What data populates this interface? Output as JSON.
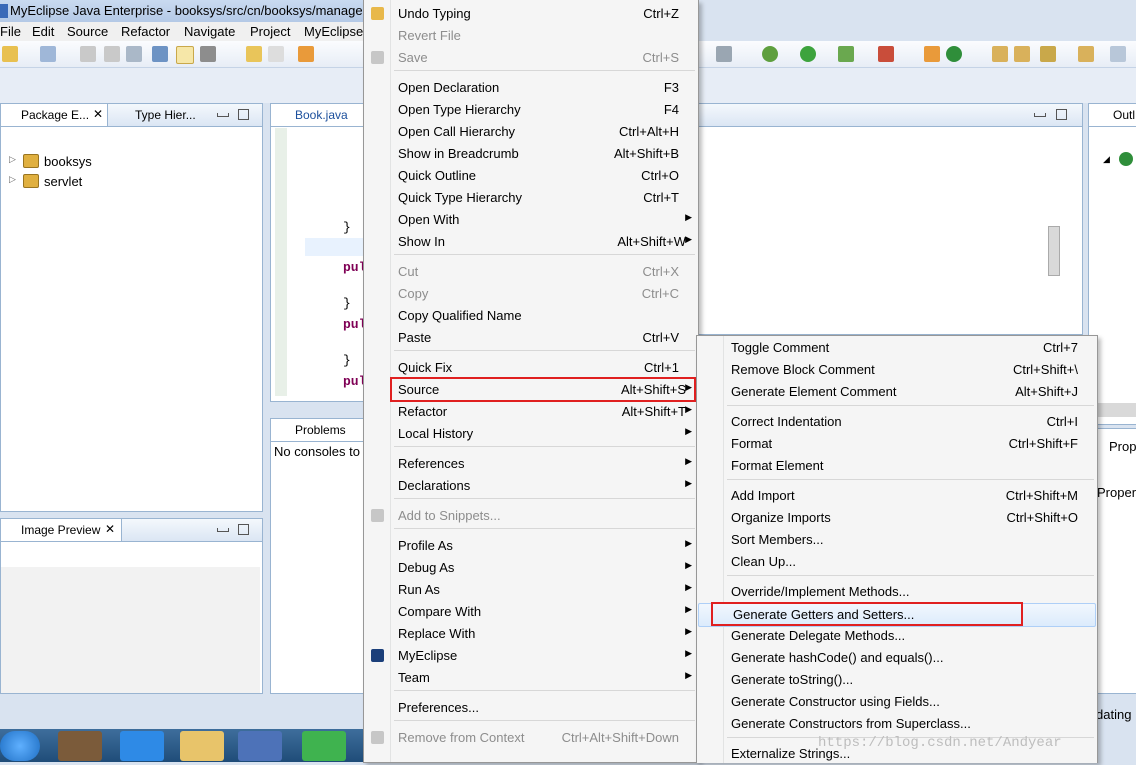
{
  "window": {
    "title": "MyEclipse Java Enterprise - booksys/src/cn/booksys/manage"
  },
  "menubar": [
    "File",
    "Edit",
    "Source",
    "Refactor",
    "Navigate",
    "Project",
    "MyEclipse"
  ],
  "package_explorer": {
    "tabs": [
      "Package E...",
      "Type Hier..."
    ],
    "projects": [
      "booksys",
      "servlet"
    ]
  },
  "editor": {
    "tab": "Book.java",
    "lines": [
      "}",
      "pul",
      "}",
      "pul",
      "}",
      "pul"
    ]
  },
  "bottom_panel": {
    "tab": "Problems",
    "message": "No consoles to"
  },
  "image_preview": {
    "tab": "Image Preview"
  },
  "right_panel": {
    "outline_tab": "Outl",
    "prop_tab": "Prop",
    "prop_text": "Proper",
    "status_text": "dating"
  },
  "context_menu": {
    "items": [
      {
        "label": "Undo Typing",
        "shortcut": "Ctrl+Z",
        "enabled": true,
        "submenu": false
      },
      {
        "label": "Revert File",
        "shortcut": "",
        "enabled": false,
        "submenu": false
      },
      {
        "label": "Save",
        "shortcut": "Ctrl+S",
        "enabled": false,
        "submenu": false
      },
      {
        "label": "Open Declaration",
        "shortcut": "F3",
        "enabled": true,
        "submenu": false
      },
      {
        "label": "Open Type Hierarchy",
        "shortcut": "F4",
        "enabled": true,
        "submenu": false
      },
      {
        "label": "Open Call Hierarchy",
        "shortcut": "Ctrl+Alt+H",
        "enabled": true,
        "submenu": false
      },
      {
        "label": "Show in Breadcrumb",
        "shortcut": "Alt+Shift+B",
        "enabled": true,
        "submenu": false
      },
      {
        "label": "Quick Outline",
        "shortcut": "Ctrl+O",
        "enabled": true,
        "submenu": false
      },
      {
        "label": "Quick Type Hierarchy",
        "shortcut": "Ctrl+T",
        "enabled": true,
        "submenu": false
      },
      {
        "label": "Open With",
        "shortcut": "",
        "enabled": true,
        "submenu": true
      },
      {
        "label": "Show In",
        "shortcut": "Alt+Shift+W",
        "enabled": true,
        "submenu": true
      },
      {
        "label": "Cut",
        "shortcut": "Ctrl+X",
        "enabled": false,
        "submenu": false
      },
      {
        "label": "Copy",
        "shortcut": "Ctrl+C",
        "enabled": false,
        "submenu": false
      },
      {
        "label": "Copy Qualified Name",
        "shortcut": "",
        "enabled": true,
        "submenu": false
      },
      {
        "label": "Paste",
        "shortcut": "Ctrl+V",
        "enabled": true,
        "submenu": false
      },
      {
        "label": "Quick Fix",
        "shortcut": "Ctrl+1",
        "enabled": true,
        "submenu": false
      },
      {
        "label": "Source",
        "shortcut": "Alt+Shift+S",
        "enabled": true,
        "submenu": true
      },
      {
        "label": "Refactor",
        "shortcut": "Alt+Shift+T",
        "enabled": true,
        "submenu": true
      },
      {
        "label": "Local History",
        "shortcut": "",
        "enabled": true,
        "submenu": true
      },
      {
        "label": "References",
        "shortcut": "",
        "enabled": true,
        "submenu": true
      },
      {
        "label": "Declarations",
        "shortcut": "",
        "enabled": true,
        "submenu": true
      },
      {
        "label": "Add to Snippets...",
        "shortcut": "",
        "enabled": false,
        "submenu": false
      },
      {
        "label": "Profile As",
        "shortcut": "",
        "enabled": true,
        "submenu": true
      },
      {
        "label": "Debug As",
        "shortcut": "",
        "enabled": true,
        "submenu": true
      },
      {
        "label": "Run As",
        "shortcut": "",
        "enabled": true,
        "submenu": true
      },
      {
        "label": "Compare With",
        "shortcut": "",
        "enabled": true,
        "submenu": true
      },
      {
        "label": "Replace With",
        "shortcut": "",
        "enabled": true,
        "submenu": true
      },
      {
        "label": "MyEclipse",
        "shortcut": "",
        "enabled": true,
        "submenu": true
      },
      {
        "label": "Team",
        "shortcut": "",
        "enabled": true,
        "submenu": true
      },
      {
        "label": "Preferences...",
        "shortcut": "",
        "enabled": true,
        "submenu": false
      },
      {
        "label": "Remove from Context",
        "shortcut": "Ctrl+Alt+Shift+Down",
        "enabled": false,
        "submenu": false
      }
    ]
  },
  "source_submenu": {
    "items": [
      {
        "label": "Toggle Comment",
        "shortcut": "Ctrl+7"
      },
      {
        "label": "Remove Block Comment",
        "shortcut": "Ctrl+Shift+\\"
      },
      {
        "label": "Generate Element Comment",
        "shortcut": "Alt+Shift+J"
      },
      {
        "label": "Correct Indentation",
        "shortcut": "Ctrl+I"
      },
      {
        "label": "Format",
        "shortcut": "Ctrl+Shift+F"
      },
      {
        "label": "Format Element",
        "shortcut": ""
      },
      {
        "label": "Add Import",
        "shortcut": "Ctrl+Shift+M"
      },
      {
        "label": "Organize Imports",
        "shortcut": "Ctrl+Shift+O"
      },
      {
        "label": "Sort Members...",
        "shortcut": ""
      },
      {
        "label": "Clean Up...",
        "shortcut": ""
      },
      {
        "label": "Override/Implement Methods...",
        "shortcut": ""
      },
      {
        "label": "Generate Getters and Setters...",
        "shortcut": ""
      },
      {
        "label": "Generate Delegate Methods...",
        "shortcut": ""
      },
      {
        "label": "Generate hashCode() and equals()...",
        "shortcut": ""
      },
      {
        "label": "Generate toString()...",
        "shortcut": ""
      },
      {
        "label": "Generate Constructor using Fields...",
        "shortcut": ""
      },
      {
        "label": "Generate Constructors from Superclass...",
        "shortcut": ""
      },
      {
        "label": "Externalize Strings...",
        "shortcut": ""
      }
    ]
  },
  "watermark": "https://blog.csdn.net/Andyear"
}
